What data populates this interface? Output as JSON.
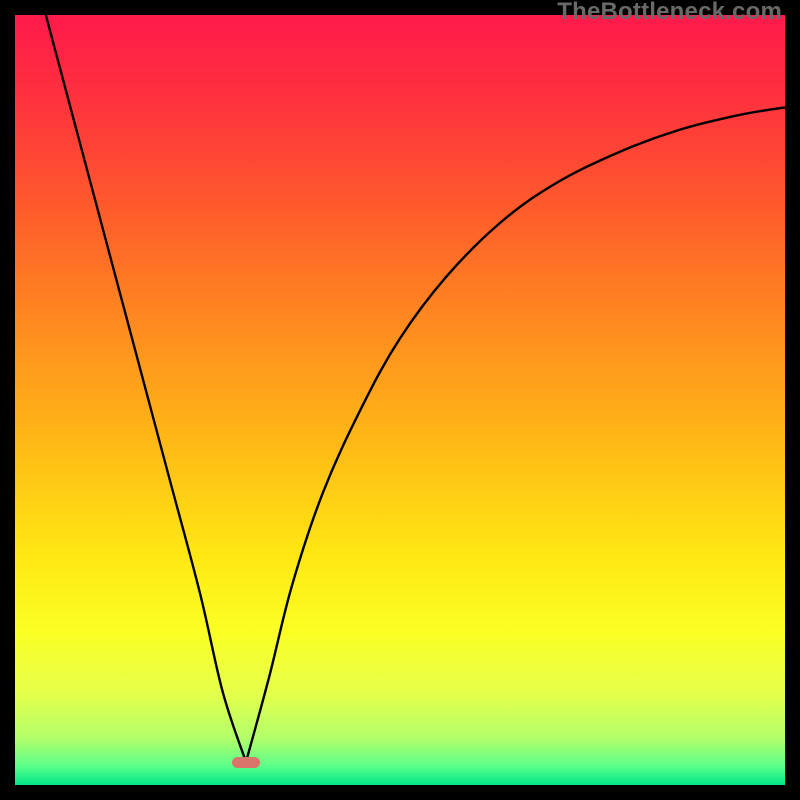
{
  "watermark": "TheBottleneck.com",
  "colors": {
    "bg": "#000000",
    "gradient_stops": [
      {
        "offset": 0.0,
        "color": "#ff1a4b"
      },
      {
        "offset": 0.1,
        "color": "#ff2f3f"
      },
      {
        "offset": 0.25,
        "color": "#ff5a2c"
      },
      {
        "offset": 0.4,
        "color": "#ff8a1f"
      },
      {
        "offset": 0.55,
        "color": "#ffb716"
      },
      {
        "offset": 0.7,
        "color": "#ffe713"
      },
      {
        "offset": 0.8,
        "color": "#fbff24"
      },
      {
        "offset": 0.88,
        "color": "#e6ff4a"
      },
      {
        "offset": 0.94,
        "color": "#b1ff6a"
      },
      {
        "offset": 0.975,
        "color": "#5cff8a"
      },
      {
        "offset": 1.0,
        "color": "#00e58a"
      }
    ],
    "curve": "#000000",
    "marker": "#d9756b"
  },
  "chart_data": {
    "type": "line",
    "title": "",
    "xlabel": "",
    "ylabel": "",
    "x_range": [
      0,
      100
    ],
    "y_range": [
      0,
      100
    ],
    "notch_x": 30,
    "notch_y": 3,
    "left_branch": [
      {
        "x": 4,
        "y": 100
      },
      {
        "x": 8,
        "y": 85
      },
      {
        "x": 12,
        "y": 70
      },
      {
        "x": 16,
        "y": 55
      },
      {
        "x": 20,
        "y": 40
      },
      {
        "x": 24,
        "y": 25
      },
      {
        "x": 27,
        "y": 12
      },
      {
        "x": 30,
        "y": 3
      }
    ],
    "right_branch": [
      {
        "x": 30,
        "y": 3
      },
      {
        "x": 33,
        "y": 14
      },
      {
        "x": 36,
        "y": 26
      },
      {
        "x": 40,
        "y": 38
      },
      {
        "x": 45,
        "y": 49
      },
      {
        "x": 50,
        "y": 58
      },
      {
        "x": 56,
        "y": 66
      },
      {
        "x": 63,
        "y": 73
      },
      {
        "x": 70,
        "y": 78
      },
      {
        "x": 78,
        "y": 82
      },
      {
        "x": 86,
        "y": 85
      },
      {
        "x": 94,
        "y": 87
      },
      {
        "x": 100,
        "y": 88
      }
    ],
    "marker": {
      "x": 30,
      "y": 3
    }
  }
}
